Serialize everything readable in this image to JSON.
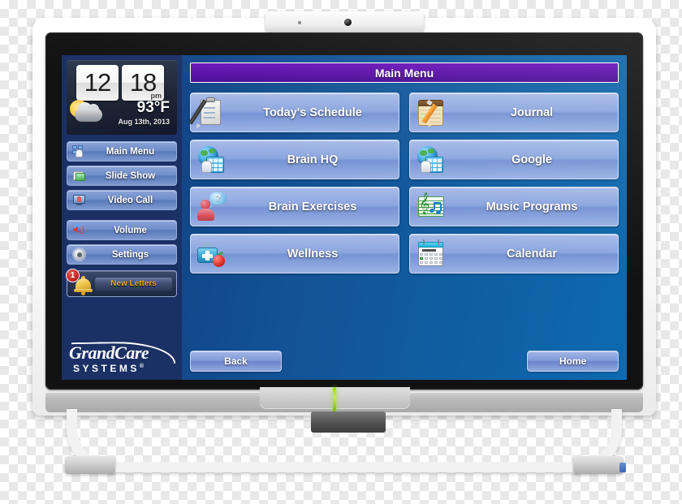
{
  "device": {
    "name": "grandcare-touchscreen-monitor",
    "webcam": "webcam-icon",
    "status_led_color": "#9bdb12"
  },
  "clock_widget": {
    "hours": "12",
    "minutes": "18",
    "meridiem": "pm",
    "temperature": "93°F",
    "date": "Aug 13th, 2013",
    "weather_icon": "sun-behind-cloud-icon"
  },
  "sidebar": {
    "items": [
      {
        "label": "Main Menu",
        "icon": "grid-hand-icon"
      },
      {
        "label": "Slide Show",
        "icon": "photos-icon"
      },
      {
        "label": "Video Call",
        "icon": "video-monitor-icon"
      },
      {
        "label": "Volume",
        "icon": "speaker-icon"
      },
      {
        "label": "Settings",
        "icon": "gear-icon"
      }
    ],
    "notification": {
      "label": "New Letters",
      "count": "1",
      "icon": "bell-icon"
    },
    "logo": {
      "brand": "GrandCare",
      "subtitle": "SYSTEMS",
      "registered": "®"
    }
  },
  "main": {
    "title": "Main Menu",
    "buttons": [
      {
        "label": "Today's Schedule",
        "icon": "clipboard-pen-icon"
      },
      {
        "label": "Journal",
        "icon": "notebook-pencil-icon"
      },
      {
        "label": "Brain HQ",
        "icon": "globe-keypad-icon"
      },
      {
        "label": "Google",
        "icon": "globe-keypad-icon"
      },
      {
        "label": "Brain Exercises",
        "icon": "person-question-icon"
      },
      {
        "label": "Music Programs",
        "icon": "music-sheet-icon"
      },
      {
        "label": "Wellness",
        "icon": "medical-kit-apple-icon"
      },
      {
        "label": "Calendar",
        "icon": "calendar-icon"
      }
    ]
  },
  "footer": {
    "back_label": "Back",
    "home_label": "Home"
  },
  "colors": {
    "title_bar": "#5a0fa8",
    "sidebar_bg": "#1b3064",
    "screen_bg": "#135395",
    "button_blue": "#8ca6de",
    "badge_red": "#c01f18",
    "letters_text": "#f0a81e"
  }
}
